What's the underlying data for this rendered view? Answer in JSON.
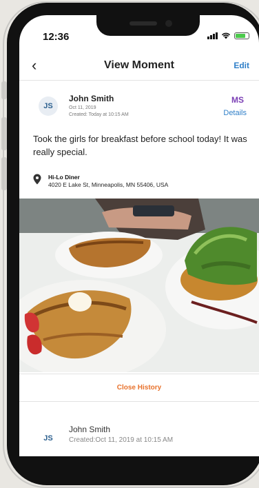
{
  "status_bar": {
    "time": "12:36"
  },
  "nav": {
    "back_icon": "chevron-left-icon",
    "title": "View Moment",
    "edit_label": "Edit"
  },
  "moment": {
    "avatar_initials": "JS",
    "author": "John Smith",
    "date": "Oct 11, 2019",
    "created": "Created: Today at 10:15 AM",
    "tag_initials": "MS",
    "details_label": "Details",
    "text": "Took the girls for breakfast before school today! It was really special.",
    "location_icon": "map-pin-icon",
    "location_name": "Hi-Lo Diner",
    "location_address": "4020 E Lake St, Minneapolis, MN 55406, USA"
  },
  "photo": {
    "icon": "breakfast-photo"
  },
  "history": {
    "close_label": "Close History",
    "entries": [
      {
        "avatar_initials": "JS",
        "author": "John Smith",
        "created": "Created:Oct 11, 2019 at 10:15 AM"
      }
    ]
  },
  "colors": {
    "accent_blue": "#2f7fc8",
    "accent_orange": "#e8722c",
    "tag_purple": "#7b3fb5"
  }
}
